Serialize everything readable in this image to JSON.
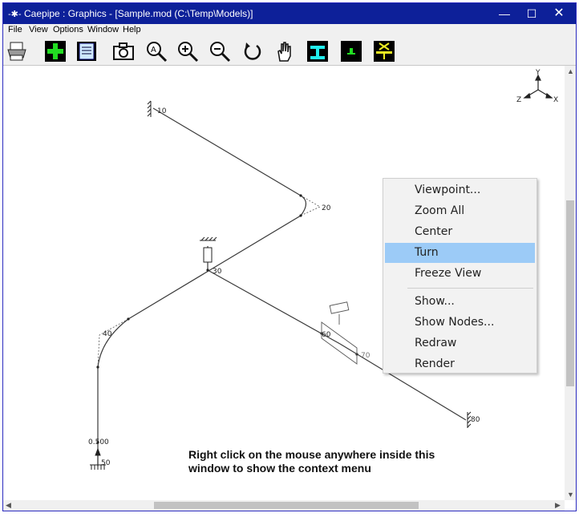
{
  "window": {
    "title": "Caepipe : Graphics -  [Sample.mod (C:\\Temp\\Models)]",
    "app_icon": "-✱-",
    "controls": {
      "minimize": "—",
      "maximize": "☐",
      "close": "✕"
    }
  },
  "menu": {
    "items": [
      "File",
      "View",
      "Options",
      "Window",
      "Help"
    ]
  },
  "toolbar": {
    "buttons": [
      "print-icon",
      "add-icon",
      "document-icon",
      "camera-icon",
      "zoom-all-icon",
      "zoom-in-icon",
      "zoom-out-icon",
      "rotate-icon",
      "pan-hand-icon",
      "beam-icon",
      "section-icon",
      "support-icon"
    ]
  },
  "model": {
    "node_labels": [
      "10",
      "20",
      "30",
      "40",
      "0.500",
      "50",
      "60",
      "70",
      "80"
    ]
  },
  "axes": {
    "x": "X",
    "y": "Y",
    "z": "Z"
  },
  "context_menu": {
    "items": [
      "Viewpoint...",
      "Zoom All",
      "Center",
      "Turn",
      "Freeze View",
      "Show...",
      "Show Nodes...",
      "Redraw",
      "Render"
    ],
    "highlighted": "Turn",
    "highlight_color": "#9ccbf7"
  },
  "hint": {
    "line1": "Right click on the mouse anywhere inside this",
    "line2": "window to show the context menu"
  },
  "colors": {
    "titlebar": "#0d2099",
    "pipe": "#3a3a3a",
    "toolbar_bg": "#f0f0f0"
  }
}
